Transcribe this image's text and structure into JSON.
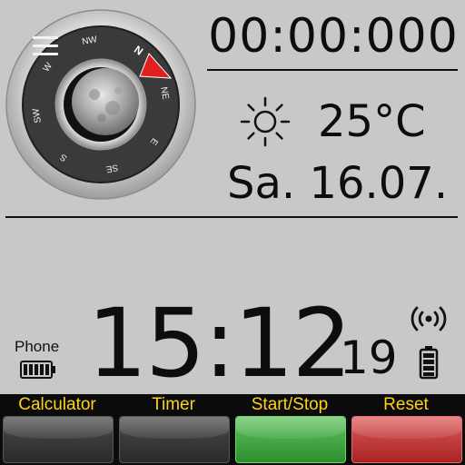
{
  "compass": {
    "directions": [
      "N",
      "NE",
      "E",
      "SE",
      "S",
      "SW",
      "W",
      "NW"
    ],
    "needle_color": "#e02020",
    "icon": "moon-icon"
  },
  "menu": {
    "icon": "hamburger-menu-icon"
  },
  "stopwatch": {
    "display": "00:00:000"
  },
  "weather": {
    "icon": "sun-icon",
    "temperature": "25°C"
  },
  "date": {
    "display": "Sa. 16.07."
  },
  "phone": {
    "label": "Phone",
    "battery_icon": "battery-icon"
  },
  "clock": {
    "hours_minutes": "15:12",
    "seconds": "19"
  },
  "watch_status": {
    "signal_icon": "broadcast-signal-icon",
    "battery_icon": "battery-icon"
  },
  "buttons": {
    "calculator": "Calculator",
    "timer": "Timer",
    "start_stop": "Start/Stop",
    "reset": "Reset"
  },
  "colors": {
    "background": "#c8c8c8",
    "button_label": "#ffd21a",
    "start_button": "#3fa33f",
    "reset_button": "#c63a3a"
  }
}
